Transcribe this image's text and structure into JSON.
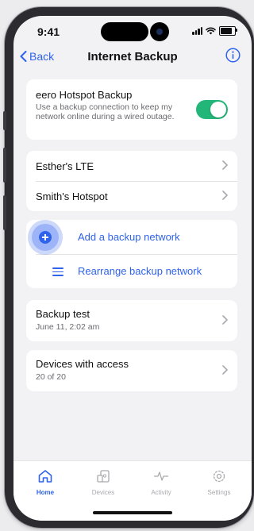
{
  "status_bar": {
    "time": "9:41"
  },
  "nav": {
    "back_label": "Back",
    "title": "Internet Backup",
    "info_icon": "info-icon"
  },
  "hotspot": {
    "title": "eero Hotspot Backup",
    "description": "Use a backup connection to keep my network online during a wired outage.",
    "enabled": true
  },
  "networks": [
    {
      "label": "Esther's LTE"
    },
    {
      "label": "Smith's Hotspot"
    }
  ],
  "actions": {
    "add_label": "Add a backup network",
    "rearrange_label": "Rearrange backup network"
  },
  "backup_test": {
    "title": "Backup test",
    "subtitle": "June 11, 2:02 am"
  },
  "devices_access": {
    "title": "Devices with access",
    "subtitle": "20 of 20"
  },
  "tabs": [
    {
      "label": "Home",
      "icon": "home-icon",
      "active": true
    },
    {
      "label": "Devices",
      "icon": "devices-icon",
      "active": false
    },
    {
      "label": "Activity",
      "icon": "activity-icon",
      "active": false
    },
    {
      "label": "Settings",
      "icon": "settings-icon",
      "active": false
    }
  ],
  "colors": {
    "accent": "#2f63ec",
    "toggle_on": "#22b678",
    "background": "#f2f2f5"
  }
}
